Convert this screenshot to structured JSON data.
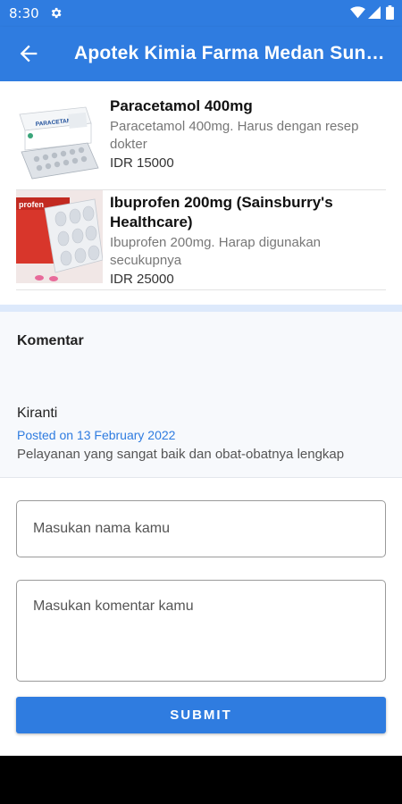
{
  "status_bar": {
    "time": "8:30",
    "icons": [
      "gear-icon",
      "wifi-icon",
      "signal-icon",
      "battery-icon"
    ]
  },
  "app_bar": {
    "title": "Apotek Kimia Farma Medan Sun…",
    "back_icon": "arrow-left-icon"
  },
  "products": [
    {
      "name": "Paracetamol 400mg",
      "description": "Paracetamol 400mg. Harus dengan resep dokter",
      "price": "IDR 15000",
      "box_text": "PARACETAMOL"
    },
    {
      "name": "Ibuprofen 200mg (Sainsburry's Healthcare)",
      "description": "Ibuprofen 200mg. Harap digunakan secukupnya",
      "price": "IDR 25000",
      "box_text": "profen"
    }
  ],
  "comments": {
    "heading": "Komentar",
    "items": [
      {
        "author": "Kiranti",
        "date": "Posted on 13 February 2022",
        "text": "Pelayanan yang sangat baik dan obat-obatnya lengkap"
      }
    ]
  },
  "form": {
    "name_placeholder": "Masukan nama kamu",
    "comment_placeholder": "Masukan komentar kamu",
    "submit_label": "SUBMIT"
  },
  "colors": {
    "primary": "#2f7ce0",
    "date_text": "#2f7ce0",
    "section_band": "#dde9fb"
  }
}
